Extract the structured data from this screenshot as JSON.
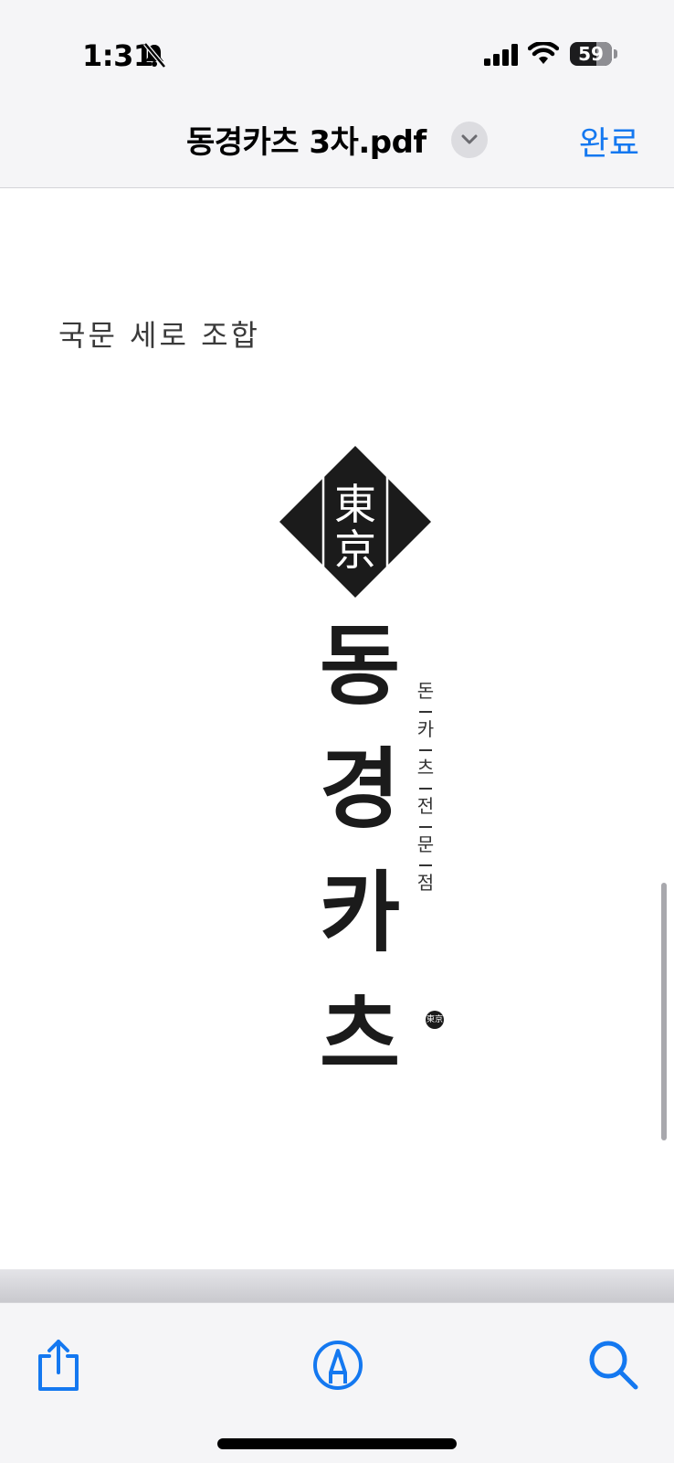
{
  "status_bar": {
    "time": "1:31",
    "battery_level": "59",
    "icons": [
      "bell-slash-icon",
      "cellular-signal-icon",
      "wifi-icon",
      "battery-icon"
    ]
  },
  "nav": {
    "title": "동경카츠 3차.pdf",
    "done_label": "완료",
    "accent_color": "#1478f0"
  },
  "document": {
    "heading": "국문 세로 조합",
    "logo_kanji": [
      "東",
      "京"
    ],
    "logo_main": [
      "동",
      "경",
      "카",
      "츠"
    ],
    "logo_sub": [
      "돈",
      "카",
      "츠",
      "전",
      "문",
      "점"
    ],
    "seal_text": "東京"
  },
  "toolbar": {
    "icons": [
      "share-icon",
      "markup-icon",
      "search-icon"
    ]
  }
}
